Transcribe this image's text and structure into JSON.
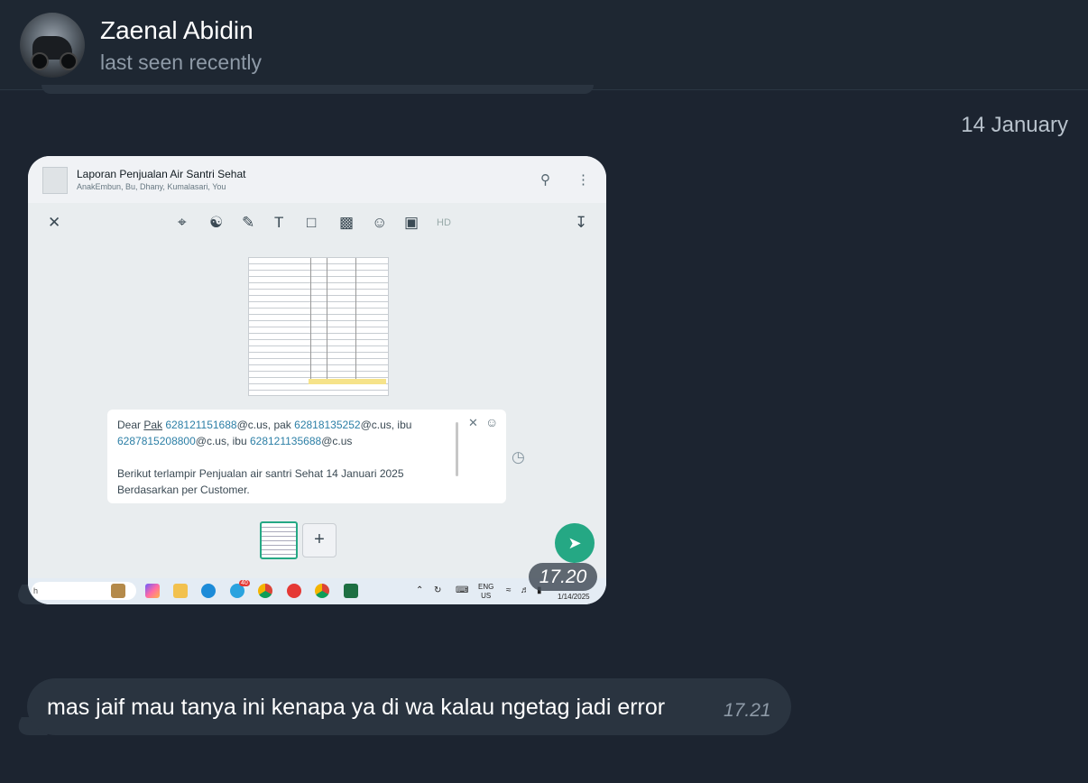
{
  "header": {
    "contact_name": "Zaenal Abidin",
    "status": "last seen recently"
  },
  "date_separator": "14 January",
  "media_message": {
    "time": "17.20",
    "screenshot": {
      "group_title": "Laporan Penjualan Air Santri Sehat",
      "group_members": "AnakEmbun, Bu, Dhany, Kumalasari, You",
      "caption_line1_parts": [
        "Dear ",
        "Pak",
        " ",
        "628121151688",
        "@c.us",
        ", pak ",
        "62818135252",
        "@c.us",
        ", ibu"
      ],
      "caption_line2_parts": [
        "6287815208800",
        "@c.us",
        ", ibu ",
        "628121135688",
        "@c.us"
      ],
      "caption_line3": "Berikut terlampir Penjualan air santri Sehat 14 Januari 2025",
      "caption_line4": "Berdasarkan per Customer.",
      "add_symbol": "+",
      "search_partial": "h",
      "lang_top": "ENG",
      "lang_bottom": "US",
      "clock_date": "1/14/2025",
      "telegram_badge": "40"
    }
  },
  "text_message": {
    "text": "mas jaif mau tanya ini kenapa ya di wa kalau ngetag jadi error",
    "time": "17.21"
  },
  "icons": {
    "close": "close-icon",
    "crop": "crop-icon",
    "send": "send-icon",
    "search": "search-icon",
    "menu": "more-vert-icon"
  },
  "colors": {
    "background": "#1c2430",
    "bubble": "#2a3440",
    "whatsapp_green": "#25a884"
  }
}
